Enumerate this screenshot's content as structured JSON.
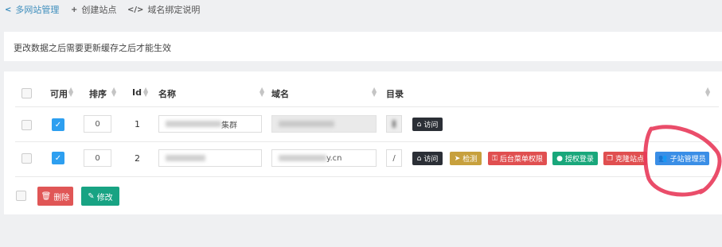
{
  "nav": {
    "items": [
      {
        "icon": "share-icon",
        "label": "多网站管理",
        "active": true
      },
      {
        "icon": "plus-icon",
        "label": "创建站点",
        "active": false
      },
      {
        "icon": "code-icon",
        "label": "域名绑定说明",
        "active": false
      }
    ]
  },
  "notice": {
    "text": "更改数据之后需要更新缓存之后才能生效"
  },
  "table": {
    "headers": {
      "enabled": "可用",
      "sort": "排序",
      "id": "Id",
      "name": "名称",
      "domain": "域名",
      "dir": "目录"
    },
    "rows": [
      {
        "enabled": true,
        "sort": "0",
        "id": "1",
        "name_suffix": "集群",
        "domain": "",
        "dir": "",
        "actions": [
          {
            "icon": "home-icon",
            "label": "访问",
            "color": "#2b2f36"
          }
        ]
      },
      {
        "enabled": true,
        "sort": "0",
        "id": "2",
        "name_suffix": "",
        "domain_suffix": "y.cn",
        "dir": "/",
        "actions": [
          {
            "icon": "home-icon",
            "label": "访问",
            "color": "#2b2f36"
          },
          {
            "icon": "send-icon",
            "label": "检测",
            "color": "#c7a03d"
          },
          {
            "icon": "lock-icon",
            "label": "后台菜单权限",
            "color": "#e04f50"
          },
          {
            "icon": "user-icon",
            "label": "授权登录",
            "color": "#19a77b"
          },
          {
            "icon": "clone-icon",
            "label": "克隆站点",
            "color": "#e04f50"
          },
          {
            "icon": "users-icon",
            "label": "子站管理员",
            "color": "#3a8ee6"
          }
        ]
      }
    ]
  },
  "footer": {
    "delete_label": "删除",
    "edit_label": "修改"
  },
  "colors": {
    "accent": "#3c8dbc",
    "annotation": "#e83a5a"
  }
}
